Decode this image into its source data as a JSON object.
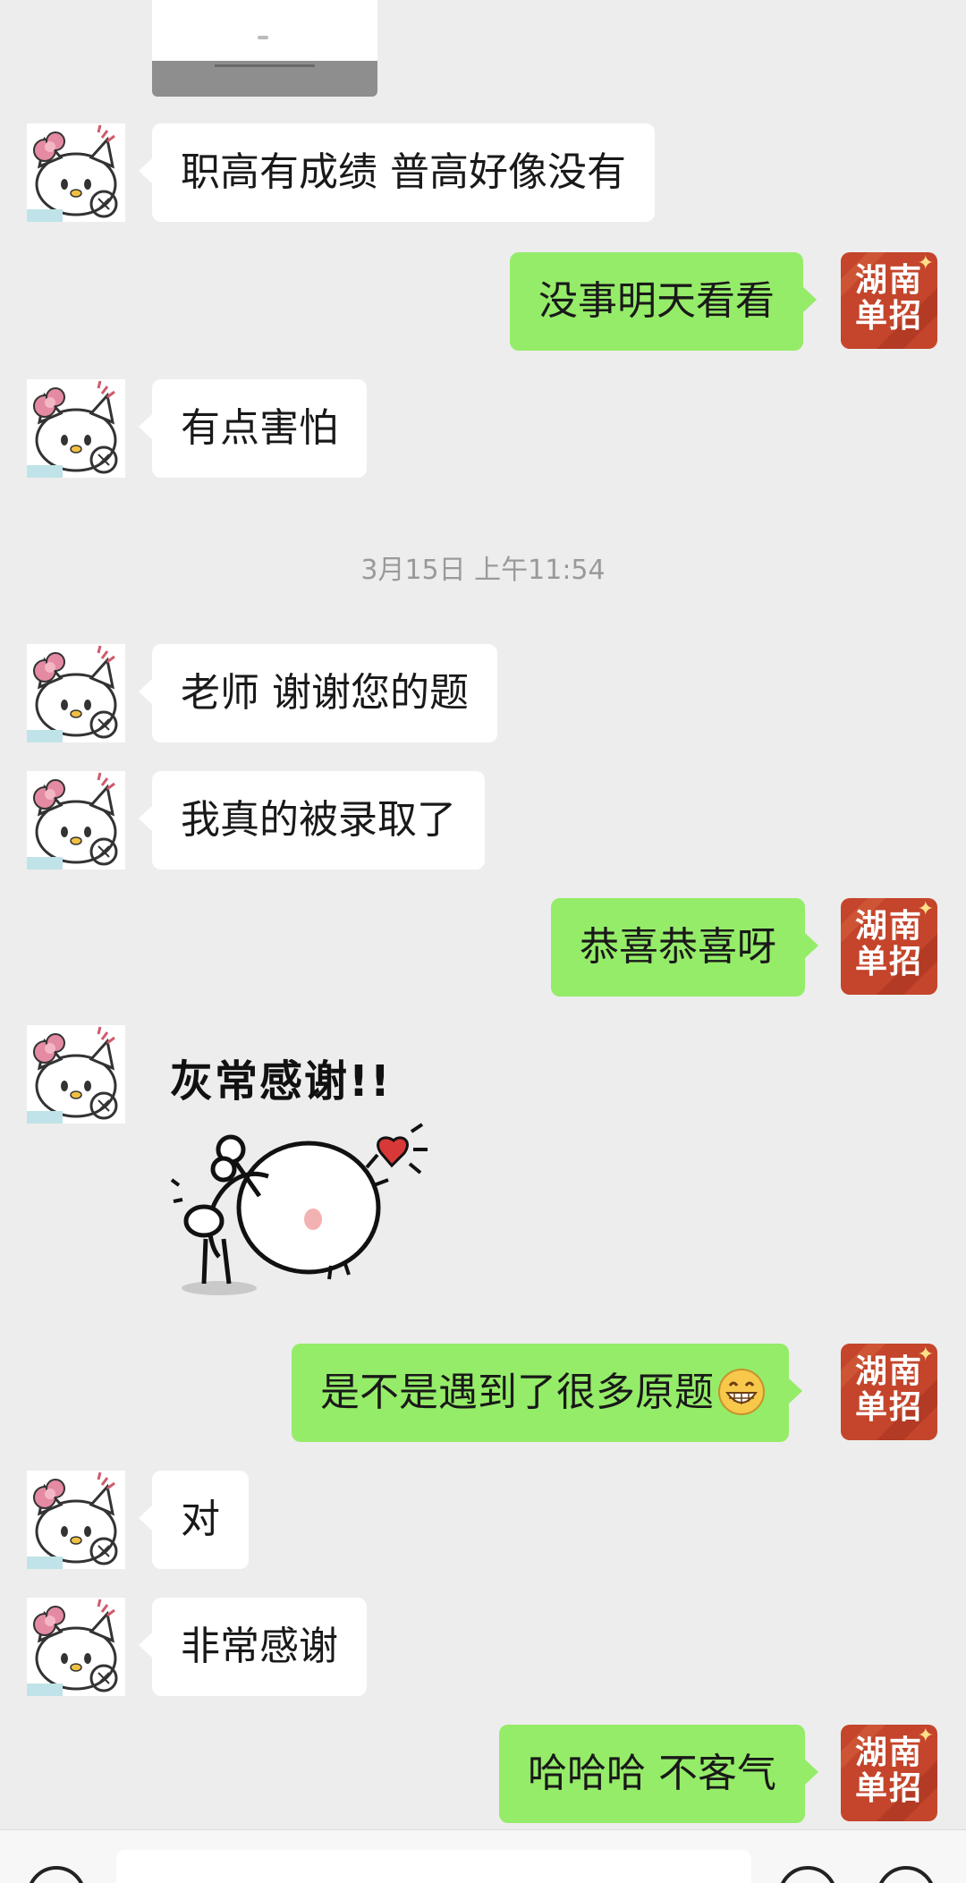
{
  "messages": {
    "m1": "职高有成绩 普高好像没有",
    "m2": "没事明天看看",
    "m3": "有点害怕",
    "timestamp": "3月15日 上午11:54",
    "m4": "老师 谢谢您的题",
    "m5": "我真的被录取了",
    "m6": "恭喜恭喜呀",
    "sticker_text": "灰常感谢!!",
    "m7": "是不是遇到了很多原题",
    "m8": "对",
    "m9": "非常感谢",
    "m10": "哈哈哈 不客气"
  },
  "brand": {
    "line1": "湖南",
    "line2": "单招",
    "color": "#c4452b"
  },
  "icons": {
    "user_avatar": "hello-kitty-avatar-icon",
    "emoji": "grinning-face-icon",
    "voice": "voice-icon",
    "emoji_button": "smile-icon",
    "more": "plus-icon"
  },
  "colors": {
    "background": "#ededed",
    "sent_bubble": "#95ec69",
    "received_bubble": "#ffffff"
  }
}
